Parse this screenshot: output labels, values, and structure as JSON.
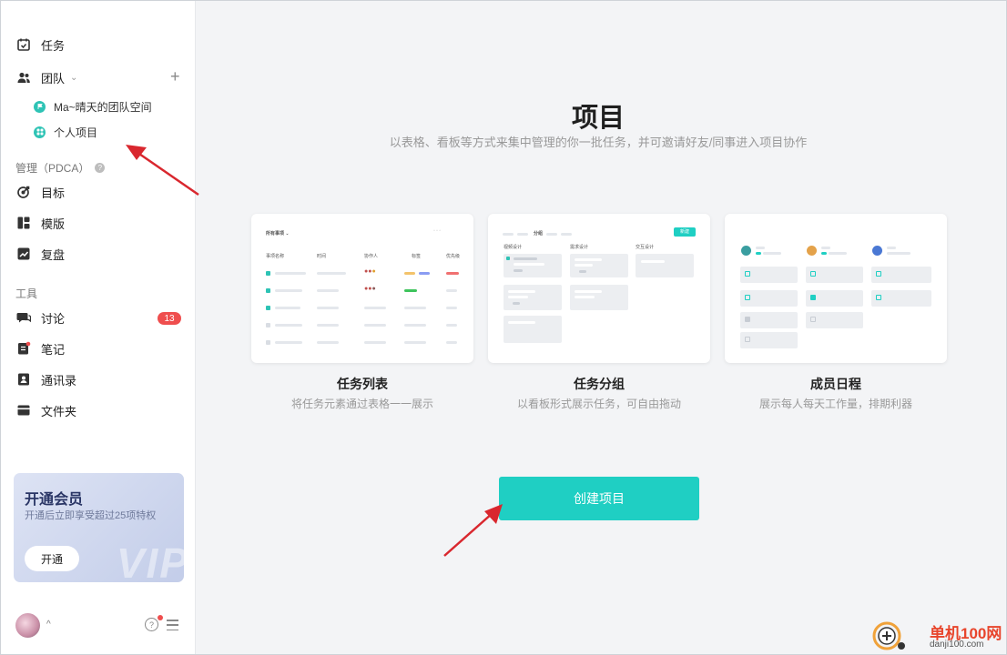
{
  "sidebar": {
    "items": [
      {
        "label": "任务",
        "icon": "calendar-check-icon"
      },
      {
        "label": "团队",
        "icon": "team-icon"
      }
    ],
    "team_spaces": [
      {
        "label": "Ma~晴天的团队空间"
      },
      {
        "label": "个人项目"
      }
    ],
    "manage_label": "管理（PDCA）",
    "manage_items": [
      {
        "label": "目标"
      },
      {
        "label": "模版"
      },
      {
        "label": "复盘"
      }
    ],
    "tools_label": "工具",
    "tool_items": [
      {
        "label": "讨论",
        "badge": "13"
      },
      {
        "label": "笔记"
      },
      {
        "label": "通讯录"
      },
      {
        "label": "文件夹"
      }
    ],
    "vip": {
      "title": "开通会员",
      "subtitle": "开通后立即享受超过25项特权",
      "button": "开通",
      "watermark": "VIP"
    }
  },
  "main": {
    "title": "项目",
    "subtitle": "以表格、看板等方式来集中管理的你一批任务，并可邀请好友/同事进入项目协作",
    "cards": [
      {
        "title": "任务列表",
        "desc": "将任务元素通过表格一一展示"
      },
      {
        "title": "任务分组",
        "desc": "以看板形式展示任务，可自由拖动"
      },
      {
        "title": "成员日程",
        "desc": "展示每人每天工作量，排期利器"
      }
    ],
    "preview_list": {
      "header": "所有事项 ⌄",
      "columns": [
        "事项名称",
        "时间",
        "协作人",
        "标签",
        "优先级"
      ]
    },
    "preview_group": {
      "tab": "分组",
      "button": "新建",
      "columns": [
        "视频设计",
        "需求设计",
        "交互设计"
      ]
    },
    "create_button": "创建项目"
  },
  "watermark": {
    "site_name": "单机100网",
    "site_url": "danji100.com"
  },
  "colors": {
    "accent": "#1fcfc3",
    "badge": "#ef4e4e",
    "arrow": "#d9272e"
  }
}
